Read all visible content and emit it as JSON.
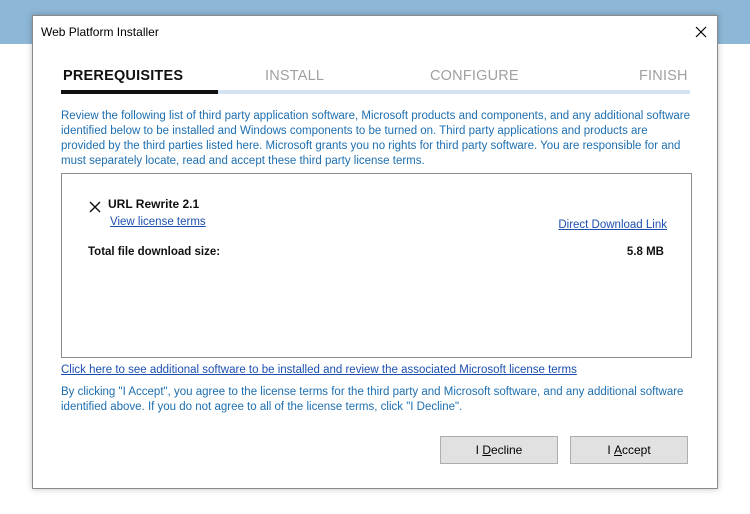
{
  "window": {
    "title": "Web Platform Installer",
    "close_icon": "close-icon"
  },
  "steps": [
    {
      "label": "PREREQUISITES",
      "active": true
    },
    {
      "label": "INSTALL",
      "active": false
    },
    {
      "label": "CONFIGURE",
      "active": false
    },
    {
      "label": "FINISH",
      "active": false
    }
  ],
  "colors": {
    "active_step_bar": "#111111",
    "inactive_step_bar": "#d3e3f1",
    "info_text": "#1e6fb0",
    "link": "#1d4fb0",
    "background_band": "#8db7d6"
  },
  "intro_text": "Review the following list of third party application software, Microsoft products and components, and any additional software identified below to be installed and Windows components to be turned on.  Third party applications and products are provided by the third parties listed here.  Microsoft grants you no rights for third party software.  You are responsible for and must separately locate, read and accept these third party license terms.",
  "item": {
    "icon": "x-icon",
    "name": "URL Rewrite 2.1",
    "license_link": "View license terms",
    "download_link": "Direct Download Link"
  },
  "total": {
    "label": "Total file download size:",
    "value": "5.8 MB"
  },
  "more_software_link": "Click here to see additional software to be installed and review the associated Microsoft license terms",
  "accept_text": "By clicking \"I Accept\", you agree to the license terms for the third party and Microsoft software, and any additional software identified above.  If you do not agree to all of the license terms, click \"I Decline\".",
  "buttons": {
    "decline_prefix": "I ",
    "decline_mnemonic": "D",
    "decline_rest": "ecline",
    "accept_prefix": "I ",
    "accept_mnemonic": "A",
    "accept_rest": "ccept"
  }
}
